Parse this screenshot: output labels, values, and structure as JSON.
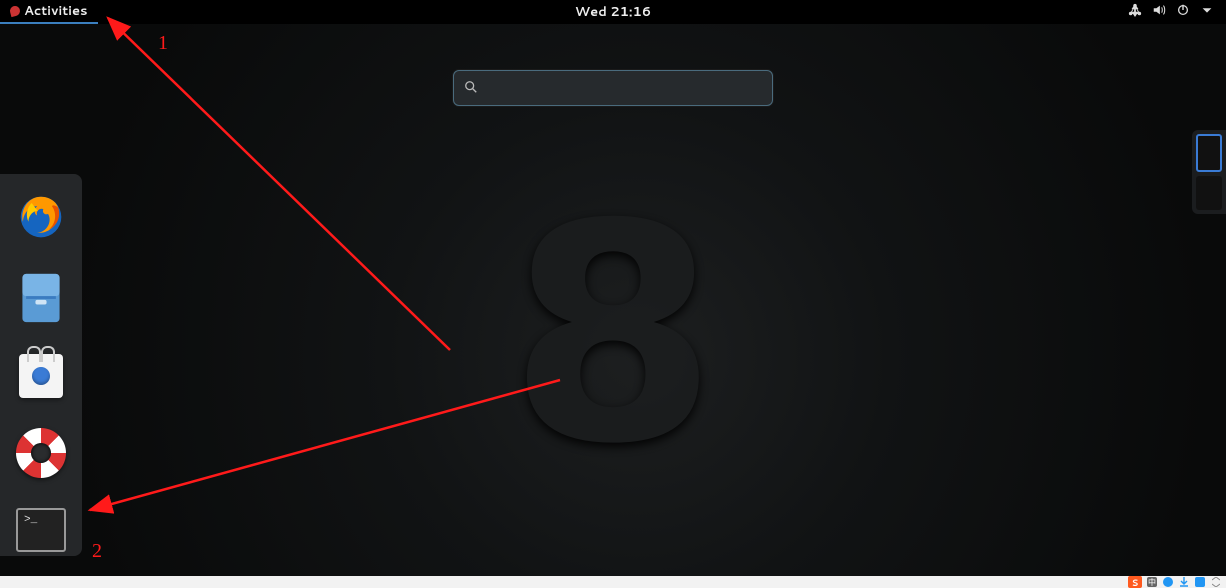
{
  "topbar": {
    "activities_label": "Activities",
    "clock": "Wed 21:16"
  },
  "tray": {
    "icons": [
      "network-icon",
      "volume-icon",
      "power-icon",
      "dropdown-icon"
    ]
  },
  "search": {
    "placeholder": "",
    "value": ""
  },
  "dash": {
    "apps": [
      {
        "name": "firefox",
        "label": "Firefox"
      },
      {
        "name": "files",
        "label": "Files"
      },
      {
        "name": "software",
        "label": "Software"
      },
      {
        "name": "help",
        "label": "Help"
      },
      {
        "name": "terminal",
        "label": "Terminal"
      }
    ]
  },
  "workspaces": {
    "count": 2,
    "active": 0
  },
  "annotations": {
    "label1": "1",
    "label2": "2"
  },
  "hostbar": {
    "ime": "S",
    "lang": "中"
  }
}
